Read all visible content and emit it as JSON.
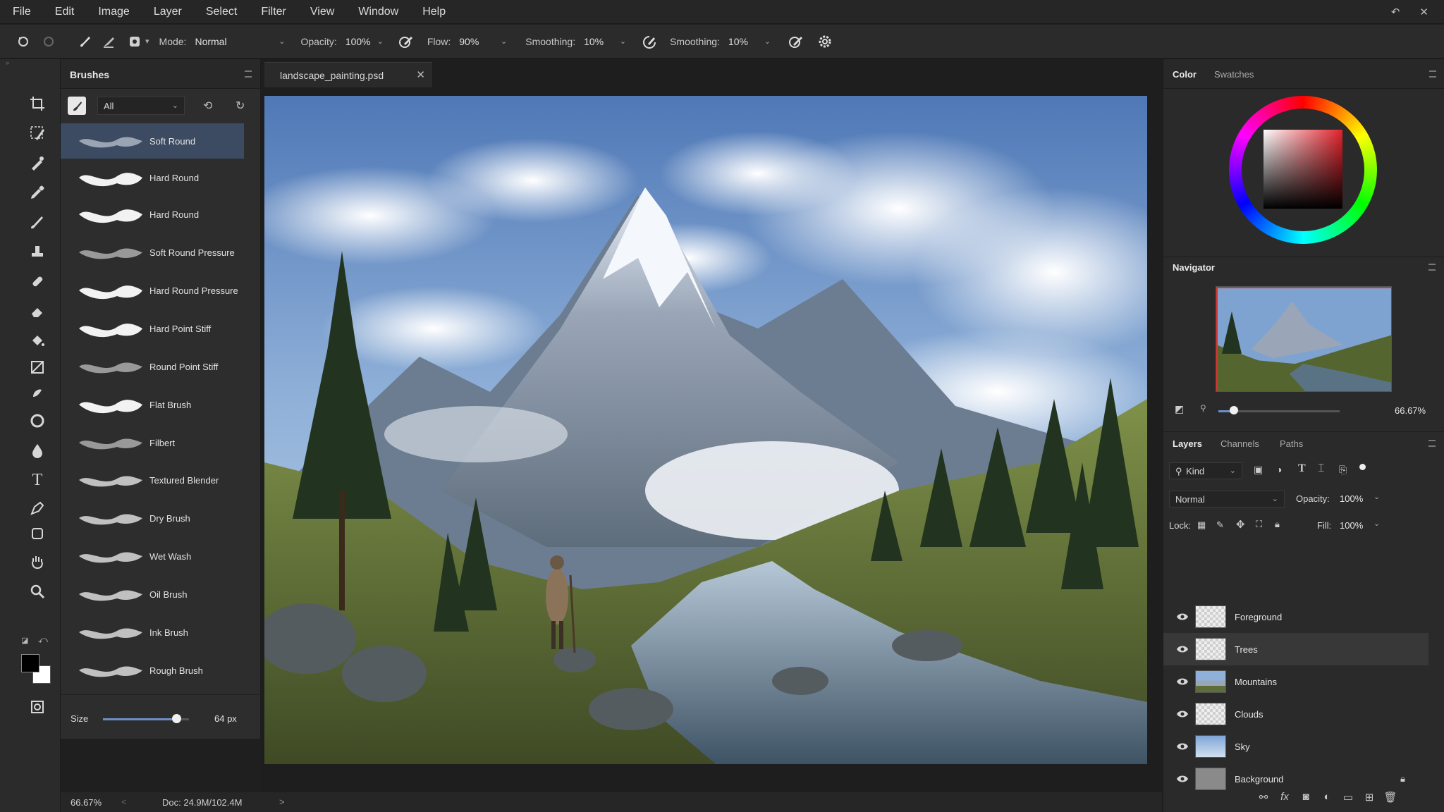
{
  "menu": [
    "File",
    "Edit",
    "Image",
    "Layer",
    "Select",
    "Filter",
    "View",
    "Window",
    "Help"
  ],
  "options": {
    "mode_label": "Mode:",
    "mode_value": "Normal",
    "opacity_label": "Opacity:",
    "opacity_value": "100%",
    "flow_label": "Flow:",
    "flow_value": "90%",
    "smoothing_label": "Smoothing:",
    "smoothing_value": "10%",
    "smoothing2_label": "Smoothing:",
    "smoothing2_value": "10%"
  },
  "brushes": {
    "title": "Brushes",
    "filter_value": "All",
    "items": [
      {
        "name": "Soft Round",
        "selected": true
      },
      {
        "name": "Hard Round"
      },
      {
        "name": "Hard Round"
      },
      {
        "name": "Soft Round Pressure"
      },
      {
        "name": "Hard Round Pressure"
      },
      {
        "name": "Hard Point Stiff"
      },
      {
        "name": "Round Point Stiff"
      },
      {
        "name": "Flat Brush"
      },
      {
        "name": "Filbert"
      },
      {
        "name": "Textured Blender"
      },
      {
        "name": "Dry Brush"
      },
      {
        "name": "Wet Wash"
      },
      {
        "name": "Oil Brush"
      },
      {
        "name": "Ink Brush"
      },
      {
        "name": "Rough Brush"
      }
    ],
    "size_label": "Size",
    "size_value": "64 px",
    "size_fraction": 0.85
  },
  "document": {
    "tab_name": "landscape_painting.psd"
  },
  "status": {
    "zoom": "66.67%",
    "doc": "Doc: 24.9M/102.4M"
  },
  "color": {
    "tab_active": "Color",
    "tab_other": "Swatches",
    "fg": "#000000",
    "bg": "#ffffff"
  },
  "navigator": {
    "title": "Navigator",
    "zoom": "66.67%",
    "zoom_fraction": 0.13
  },
  "layers": {
    "tabs": [
      "Layers",
      "Channels",
      "Paths"
    ],
    "kind_label": "Kind",
    "blend_mode": "Normal",
    "opacity_label": "Opacity:",
    "opacity_value": "100%",
    "lock_label": "Lock:",
    "fill_label": "Fill:",
    "fill_value": "100%",
    "items": [
      {
        "name": "Foreground",
        "thumb": "transparent"
      },
      {
        "name": "Trees",
        "thumb": "transparent",
        "selected": true
      },
      {
        "name": "Mountains",
        "thumb": "mountain"
      },
      {
        "name": "Clouds",
        "thumb": "transparent"
      },
      {
        "name": "Sky",
        "thumb": "sky"
      },
      {
        "name": "Background",
        "thumb": "gray",
        "locked": true
      }
    ]
  }
}
